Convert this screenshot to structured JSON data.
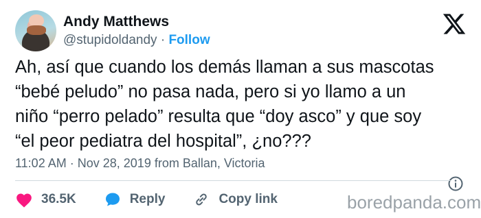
{
  "author": {
    "name": "Andy Matthews",
    "handle": "@stupidoldandy",
    "separator": "·",
    "follow_label": "Follow"
  },
  "tweet": {
    "lines": [
      "Ah, así que cuando los demás llaman a sus mascotas",
      "“bebé peludo” no pasa nada, pero si yo llamo a un",
      "niño “perro pelado” resulta que “doy asco” y que soy",
      "“el peor pediatra del hospital”, ¿no???"
    ]
  },
  "meta": {
    "time": "11:02 AM",
    "separator": "·",
    "date_location": "Nov 28, 2019 from Ballan, Victoria"
  },
  "actions": {
    "likes_count": "36.5K",
    "reply_label": "Reply",
    "copy_link_label": "Copy link"
  },
  "icons": {
    "logo": "x-logo-icon",
    "like": "heart-icon",
    "reply": "speech-bubble-icon",
    "copy": "link-icon",
    "info": "info-icon"
  },
  "colors": {
    "accent": "#1d9bf0",
    "like": "#f91880",
    "muted": "#536471",
    "text": "#0f1419"
  },
  "watermark": "boredpanda.com"
}
